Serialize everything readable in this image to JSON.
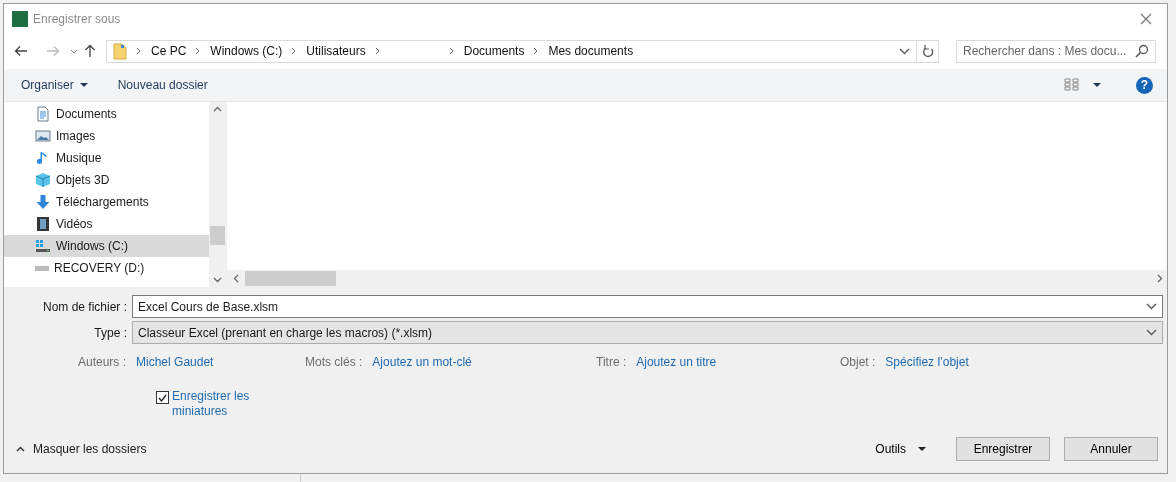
{
  "window": {
    "title": "Enregistrer sous"
  },
  "address": {
    "crumbs": [
      {
        "kind": "text",
        "label": "Ce PC"
      },
      {
        "kind": "text",
        "label": "Windows (C:)"
      },
      {
        "kind": "text",
        "label": "Utilisateurs"
      },
      {
        "kind": "blank"
      },
      {
        "kind": "text",
        "label": "Documents"
      },
      {
        "kind": "text",
        "label": "Mes documents"
      }
    ]
  },
  "search": {
    "placeholder": "Rechercher dans : Mes docu..."
  },
  "toolbar": {
    "organize": "Organiser",
    "new_folder": "Nouveau dossier",
    "help": "?"
  },
  "sidebar": {
    "items": [
      {
        "label": "Documents",
        "kind": "document",
        "selected": false
      },
      {
        "label": "Images",
        "kind": "picture",
        "selected": false
      },
      {
        "label": "Musique",
        "kind": "music",
        "selected": false
      },
      {
        "label": "Objets 3D",
        "kind": "cube",
        "selected": false
      },
      {
        "label": "Téléchargements",
        "kind": "download",
        "selected": false
      },
      {
        "label": "Vidéos",
        "kind": "film",
        "selected": false
      },
      {
        "label": "Windows (C:)",
        "kind": "drive",
        "selected": true
      },
      {
        "label": "RECOVERY (D:)",
        "kind": "drive2",
        "selected": false
      }
    ]
  },
  "form": {
    "file_name_label": "Nom de fichier :",
    "file_name": "Excel Cours de Base.xlsm",
    "type_label": "Type :",
    "type": "Classeur Excel (prenant en charge les macros) (*.xlsm)"
  },
  "metadata": [
    {
      "label": "Auteurs :",
      "value": "Michel Gaudet"
    },
    {
      "label": "Mots clés :",
      "value": "Ajoutez un mot-clé"
    },
    {
      "label": "Titre :",
      "value": "Ajoutez un titre"
    },
    {
      "label": "Objet :",
      "value": "Spécifiez l’objet"
    }
  ],
  "thumbnails": {
    "label": "Enregistrer les miniatures",
    "checked": true
  },
  "footer": {
    "hide_folders": "Masquer les dossiers",
    "tools": "Outils",
    "save": "Enregistrer",
    "cancel": "Annuler"
  }
}
